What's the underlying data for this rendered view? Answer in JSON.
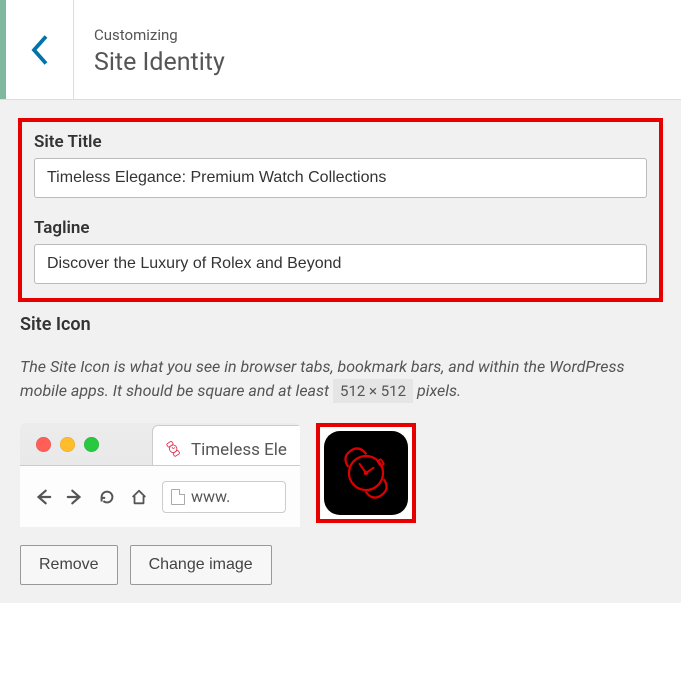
{
  "header": {
    "breadcrumb": "Customizing",
    "title": "Site Identity"
  },
  "fields": {
    "site_title_label": "Site Title",
    "site_title_value": "Timeless Elegance: Premium Watch Collections",
    "tagline_label": "Tagline",
    "tagline_value": "Discover the Luxury of Rolex and Beyond"
  },
  "site_icon": {
    "heading": "Site Icon",
    "desc_a": "The Site Icon is what you see in browser tabs, bookmark bars, and within the WordPress mobile apps. It should be square and at least ",
    "dims": "512 × 512",
    "desc_b": " pixels.",
    "tab_preview_text": "Timeless Ele",
    "url_preview": "www.",
    "remove_label": "Remove",
    "change_label": "Change image"
  }
}
